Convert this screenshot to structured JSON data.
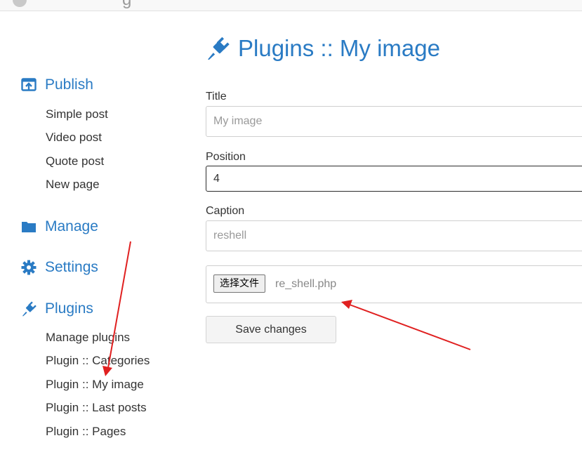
{
  "sidebar": {
    "publish": {
      "label": "Publish",
      "icon": "publish-icon",
      "items": [
        "Simple post",
        "Video post",
        "Quote post",
        "New page"
      ]
    },
    "manage": {
      "label": "Manage",
      "icon": "folder-icon"
    },
    "settings": {
      "label": "Settings",
      "icon": "gear-icon"
    },
    "plugins": {
      "label": "Plugins",
      "icon": "plug-icon",
      "items": [
        "Manage plugins",
        "Plugin :: Categories",
        "Plugin :: My image",
        "Plugin :: Last posts",
        "Plugin :: Pages"
      ]
    }
  },
  "main": {
    "title": "Plugins :: My image",
    "title_icon": "plug-icon",
    "form": {
      "title_label": "Title",
      "title_placeholder": "My image",
      "position_label": "Position",
      "position_value": "4",
      "caption_label": "Caption",
      "caption_placeholder": "reshell",
      "file_button": "选择文件",
      "file_name": "re_shell.php",
      "save_label": "Save changes"
    }
  },
  "colors": {
    "accent": "#2a7bc4",
    "annotation_arrow": "#e02020"
  }
}
